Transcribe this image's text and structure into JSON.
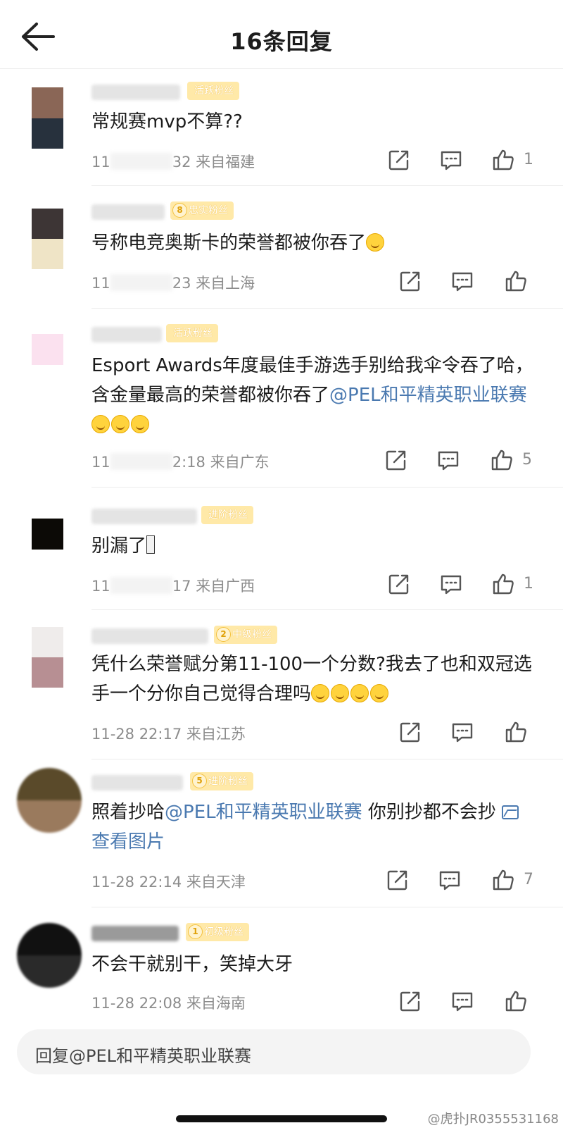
{
  "header": {
    "title": "16条回复"
  },
  "comments": [
    {
      "badge_level": "",
      "badge_label": "活跃粉丝",
      "text": "常规赛mvp不算??",
      "time_visible": "11",
      "time_tail": "32",
      "location": "来自福建",
      "likes": "1",
      "avatar_colors": [
        "#8a6656",
        "#27313d"
      ]
    },
    {
      "badge_level": "8",
      "badge_label": "忠实粉丝",
      "text": "号称电竞奥斯卡的荣誉都被你吞了",
      "time_visible": "11",
      "time_tail": "23",
      "location": "来自上海",
      "likes": "",
      "avatar_colors": [
        "#3d3535",
        "#efe4c6"
      ]
    },
    {
      "badge_level": "",
      "badge_label": "活跃粉丝",
      "text_before": "Esport Awards年度最佳手游选手别给我伞令吞了哈，含金量最高的荣誉都被你吞了",
      "mention": "@PEL和平精英职业联赛",
      "time_visible": "11",
      "time_tail": "2:18",
      "location": "来自广东",
      "likes": "5",
      "avatar_colors": [
        "#fbe1ef",
        "#fbe1ef"
      ]
    },
    {
      "badge_level": "",
      "badge_label": "进阶粉丝",
      "text": "别漏了",
      "time_visible": "11",
      "time_tail": "17",
      "location": "来自广西",
      "likes": "1",
      "avatar_colors": [
        "#0c0a06",
        "#0c0a06"
      ]
    },
    {
      "badge_level": "2",
      "badge_label": "中级粉丝",
      "text": "凭什么荣誉赋分第11-100一个分数?我去了也和双冠选手一个分你自己觉得合理吗",
      "time_visible": "11-28 22:17",
      "time_tail": "",
      "location": "来自江苏",
      "likes": "",
      "avatar_colors": [
        "#efeceb",
        "#b78f93"
      ]
    },
    {
      "badge_level": "5",
      "badge_label": "进阶粉丝",
      "text_before": "照着抄哈",
      "mention": "@PEL和平精英职业联赛",
      "text_after": " 你别抄都不会抄 ",
      "image_link": "查看图片",
      "time_visible": "11-28 22:14",
      "time_tail": "",
      "location": "来自天津",
      "likes": "7",
      "avatar_colors": [
        "#5a4a2a",
        "#9a7a5d"
      ]
    },
    {
      "badge_level": "1",
      "badge_label": "初级粉丝",
      "text": "不会干就别干，笑掉大牙",
      "time_visible": "11-28 22:08",
      "time_tail": "",
      "location": "来自海南",
      "likes": "",
      "avatar_colors": [
        "#111111",
        "#2a2a2a"
      ]
    }
  ],
  "reply_bar": {
    "placeholder": "回复@PEL和平精英职业联赛"
  },
  "watermark": "@虎扑JR0355531168",
  "icons": {
    "back": "arrow-left-icon",
    "share": "share-icon",
    "comment": "comment-icon",
    "like": "thumbs-up-icon"
  }
}
